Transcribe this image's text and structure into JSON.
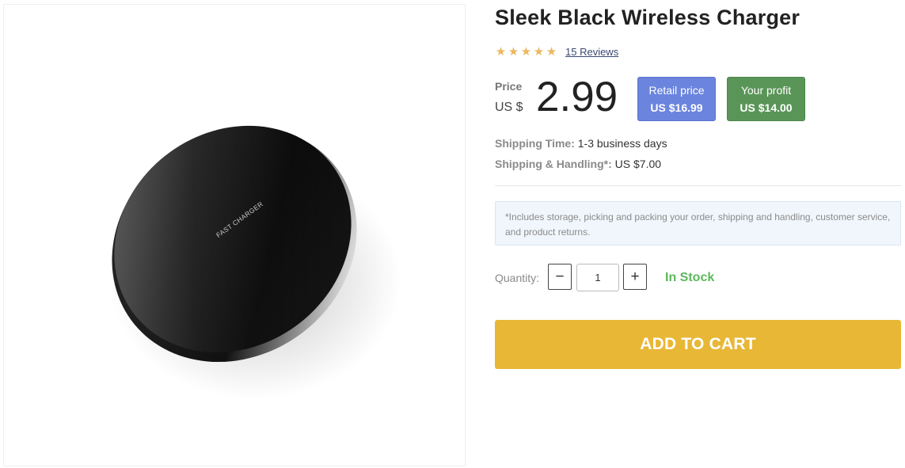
{
  "product": {
    "image_label": "FAST CHARGER",
    "title": "Sleek Black Wireless Charger",
    "rating": 5,
    "reviews_link": "15 Reviews"
  },
  "price": {
    "label": "Price",
    "currency": "US $",
    "value": "2.99"
  },
  "retail": {
    "label": "Retail price",
    "value": "US $16.99"
  },
  "profit": {
    "label": "Your profit",
    "value": "US $14.00"
  },
  "shipping": {
    "time_label": "Shipping Time:",
    "time_value": "1-3 business days",
    "handling_label": "Shipping & Handling*:",
    "handling_value": "US $7.00"
  },
  "note": "*Includes storage, picking and packing your order, shipping and handling, customer service, and product returns.",
  "quantity": {
    "label": "Quantity:",
    "value": "1",
    "minus_icon": "minus",
    "plus_icon": "plus"
  },
  "stock_status": "In Stock",
  "cart_button": "ADD TO CART",
  "colors": {
    "star": "#eab85f",
    "retail_badge": "#6b84de",
    "profit_badge": "#5a9558",
    "in_stock": "#5db85c",
    "cart_button": "#e9b736",
    "note_bg": "#f1f6fc"
  }
}
